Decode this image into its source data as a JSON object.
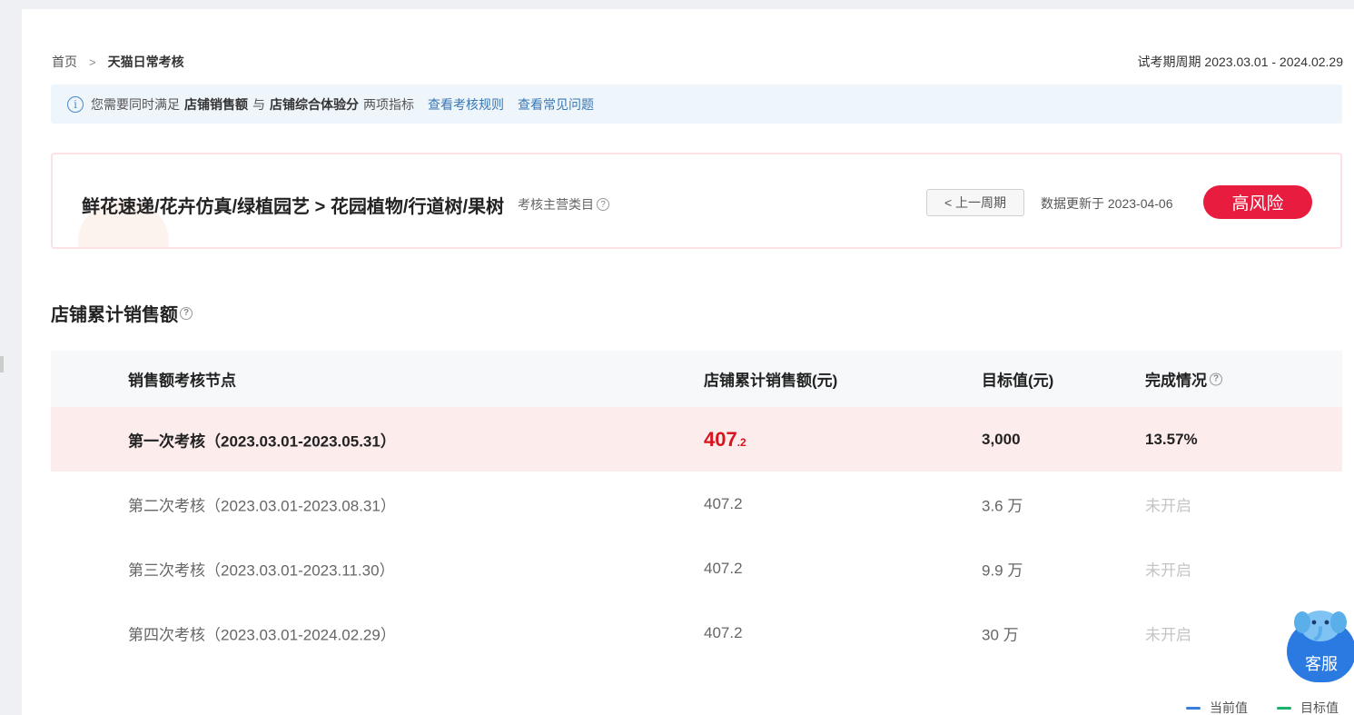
{
  "breadcrumb": {
    "home": "首页",
    "current": "天猫日常考核"
  },
  "period": "试考期周期 2023.03.01 - 2024.02.29",
  "notice": {
    "prefix": "您需要同时满足",
    "metric1": "店铺销售额",
    "and": "与",
    "metric2": "店铺综合体验分",
    "suffix": "两项指标",
    "link1": "查看考核规则",
    "link2": "查看常见问题"
  },
  "category": {
    "title": "鲜花速递/花卉仿真/绿植园艺 > 花园植物/行道树/果树",
    "subtitle": "考核主营类目",
    "prev_button": "< 上一周期",
    "updated": "数据更新于 2023-04-06",
    "risk": "高风险"
  },
  "section_title": "店铺累计销售额",
  "table": {
    "headers": [
      "销售额考核节点",
      "店铺累计销售额(元)",
      "目标值(元)",
      "完成情况"
    ],
    "rows": [
      {
        "node": "第一次考核（2023.03.01-2023.05.31）",
        "sales_int": "407",
        "sales_dec": ".2",
        "target": "3,000",
        "status": "13.57%"
      },
      {
        "node": "第二次考核（2023.03.01-2023.08.31）",
        "sales": "407.2",
        "target": "3.6 万",
        "status": "未开启"
      },
      {
        "node": "第三次考核（2023.03.01-2023.11.30）",
        "sales": "407.2",
        "target": "9.9 万",
        "status": "未开启"
      },
      {
        "node": "第四次考核（2023.03.01-2024.02.29）",
        "sales": "407.2",
        "target": "30 万",
        "status": "未开启"
      }
    ]
  },
  "legend": {
    "current": "当前值",
    "target": "目标值",
    "current_color": "#3b7ddd",
    "target_color": "#18b26b"
  },
  "service": {
    "label": "客服"
  },
  "colors": {
    "risk": "#e81c3e",
    "highlight_row": "#fdecec",
    "link": "#3a78b4"
  },
  "icons": [
    "info-icon",
    "question-icon",
    "chevron-right-icon",
    "elephant-mascot-icon"
  ]
}
